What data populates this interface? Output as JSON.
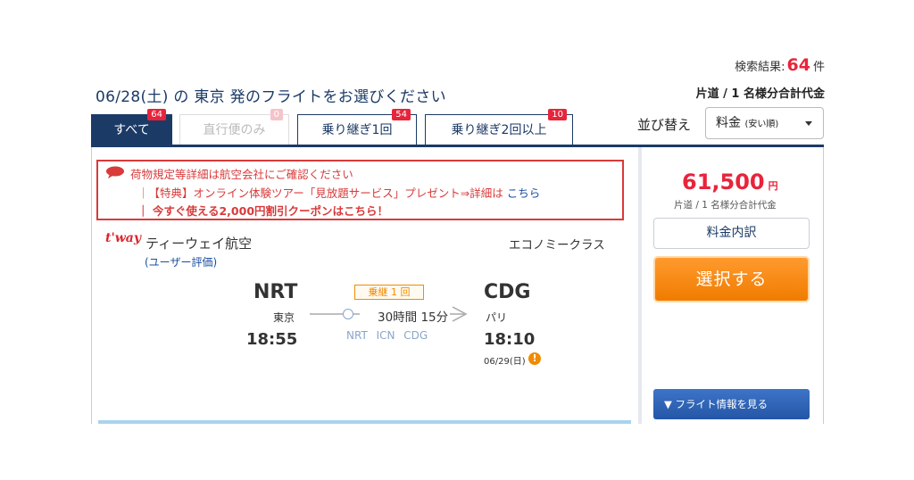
{
  "header": {
    "results_label": "検索結果:",
    "results_count": "64",
    "results_unit": "件",
    "price_basis": "片道 / 1 名様分合計代金",
    "headline": "06/28(土) の 東京 発のフライトをお選びください"
  },
  "tabs": [
    {
      "label": "すべて",
      "count": "64"
    },
    {
      "label": "直行便のみ",
      "count": "0"
    },
    {
      "label": "乗り継ぎ1回",
      "count": "54"
    },
    {
      "label": "乗り継ぎ2回以上",
      "count": "10"
    }
  ],
  "sort": {
    "label": "並び替え",
    "selected": "料金",
    "selected_note": "(安い順)"
  },
  "notice": {
    "line1": "荷物規定等詳細は航空会社にご確認ください",
    "line2": "｜【特典】オンライン体験ツアー「見放題サービス」プレゼント⇒詳細は",
    "line2_link": "こちら",
    "line3": "｜ 今すぐ使える2,000円割引クーポンはこちら！"
  },
  "flight": {
    "airline_logo": "t'way",
    "airline_name": "ティーウェイ航空",
    "user_rating": "(ユーザー評価)",
    "cabin": "エコノミークラス",
    "departure": {
      "code": "NRT",
      "city": "東京",
      "time": "18:55"
    },
    "arrival": {
      "code": "CDG",
      "city": "パリ",
      "time": "18:10",
      "date": "06/29(日)"
    },
    "transfer_badge": "乗継 1 回",
    "duration": "30時間 15分",
    "via": "NRT ICN CDG"
  },
  "pricing": {
    "price": "61,500",
    "currency": "円",
    "note": "片道 / 1 名様分合計代金",
    "breakdown_label": "料金内訳",
    "select_label": "選択する",
    "flight_info_label": "▼ フライト情報を見る"
  },
  "colors": {
    "navy": "#1b3a66",
    "red": "#e8243b",
    "orange": "#f08c00",
    "blue_button": "#2456a6"
  }
}
